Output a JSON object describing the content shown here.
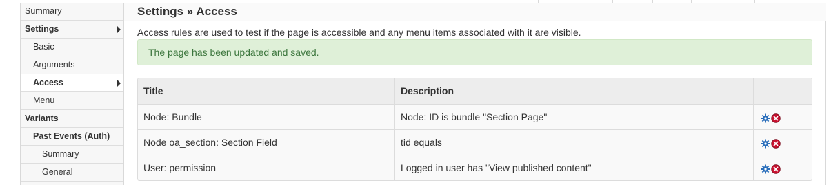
{
  "sidebar": {
    "items": [
      {
        "label": "Summary"
      },
      {
        "label": "Settings"
      },
      {
        "label": "Basic"
      },
      {
        "label": "Arguments"
      },
      {
        "label": "Access"
      },
      {
        "label": "Menu"
      },
      {
        "label": "Variants"
      },
      {
        "label": "Past Events (Auth)"
      },
      {
        "label": "Summary"
      },
      {
        "label": "General"
      }
    ]
  },
  "main": {
    "title": "Settings » Access",
    "description": "Access rules are used to test if the page is accessible and any menu items associated with it are visible.",
    "status": "The page has been updated and saved."
  },
  "table": {
    "headers": {
      "title": "Title",
      "description": "Description",
      "operations": ""
    },
    "rows": [
      {
        "title": "Node: Bundle",
        "description": "Node: ID is bundle \"Section Page\""
      },
      {
        "title": "Node oa_section: Section Field",
        "description": "tid equals"
      },
      {
        "title": "User: permission",
        "description": "Logged in user has \"View published content\""
      }
    ]
  },
  "icons": {
    "settings": "gear-icon",
    "delete": "delete-icon"
  },
  "colors": {
    "status_bg": "#dff0d8",
    "status_text": "#3c763d",
    "delete_red": "#c8102e",
    "gear_blue": "#2a6ebb"
  }
}
